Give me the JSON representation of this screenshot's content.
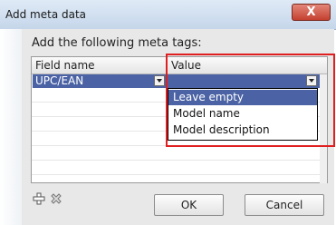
{
  "window": {
    "title": "Add meta data",
    "close_label": "X"
  },
  "prompt": "Add the following meta tags:",
  "table": {
    "headers": [
      "Field name",
      "Value"
    ],
    "rows": [
      {
        "field": "UPC/EAN",
        "value": ""
      }
    ]
  },
  "dropdown": {
    "options": [
      "Leave empty",
      "Model name",
      "Model description"
    ],
    "selected_index": 0
  },
  "buttons": {
    "ok": "OK",
    "cancel": "Cancel"
  },
  "icons": {
    "add": "plus-icon",
    "remove": "remove-icon"
  },
  "colors": {
    "selection": "#4b63a5",
    "highlight_box": "#e02020"
  }
}
